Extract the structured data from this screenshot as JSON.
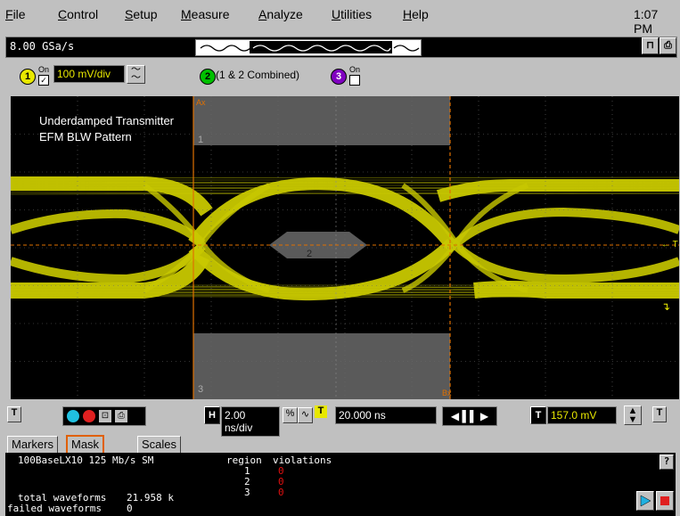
{
  "menu": {
    "items": [
      {
        "label": "File",
        "underline": "F",
        "rest": "ile"
      },
      {
        "label": "Control",
        "underline": "C",
        "rest": "ontrol"
      },
      {
        "label": "Setup",
        "underline": "S",
        "rest": "etup"
      },
      {
        "label": "Measure",
        "underline": "M",
        "rest": "easure"
      },
      {
        "label": "Analyze",
        "underline": "A",
        "rest": "nalyze"
      },
      {
        "label": "Utilities",
        "underline": "U",
        "rest": "tilities"
      },
      {
        "label": "Help",
        "underline": "H",
        "rest": "elp"
      }
    ],
    "clock": "1:07 PM"
  },
  "status": {
    "sample_rate": "8.00 GSa/s"
  },
  "channels": {
    "ch1": {
      "number": "1",
      "on_label": "On",
      "checked": true,
      "scale": "100 mV/div"
    },
    "ch2": {
      "number": "2",
      "label": "(1 & 2 Combined)"
    },
    "ch3": {
      "number": "3",
      "on_label": "On",
      "checked": false
    }
  },
  "display": {
    "annotation_line1": "Underdamped Transmitter",
    "annotation_line2": "EFM BLW Pattern",
    "marker_a": "Ax",
    "marker_b": "Bx",
    "region1": "1",
    "region2": "2",
    "region3": "3",
    "trigger_label": "← T",
    "trace_color": "#c8c800",
    "mask_color": "#5a5a5a",
    "marker_color": "#e07000"
  },
  "timebase": {
    "h_label": "H",
    "scale": "2.00 ns/div",
    "t_icon": "T",
    "delay": "20.000 ns",
    "trig_label": "T",
    "trig_level": "157.0 mV"
  },
  "tabs": [
    "Markers",
    "Mask Test",
    "Scales"
  ],
  "mask_test": {
    "mask_name": "100BaseLX10 125 Mb/s SM",
    "col_region": "region",
    "col_violations": "violations",
    "rows": [
      {
        "region": "1",
        "violations": "0"
      },
      {
        "region": "2",
        "violations": "0"
      },
      {
        "region": "3",
        "violations": "0"
      }
    ],
    "total_label": "total waveforms",
    "total_value": "21.958 k",
    "failed_label": "failed waveforms",
    "failed_value": "0",
    "help": "?"
  }
}
